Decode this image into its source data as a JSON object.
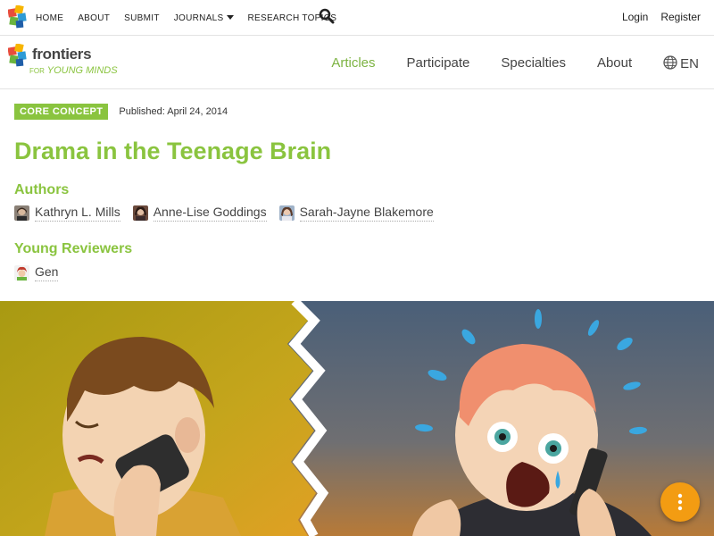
{
  "topbar": {
    "nav": [
      {
        "label": "HOME"
      },
      {
        "label": "ABOUT"
      },
      {
        "label": "SUBMIT"
      },
      {
        "label": "JOURNALS",
        "has_dropdown": true
      },
      {
        "label": "RESEARCH TOPICS"
      }
    ],
    "search_icon": "search-icon",
    "login_label": "Login",
    "register_label": "Register"
  },
  "site": {
    "brand": "frontiers",
    "tagline_for": "FOR",
    "tagline_name": "YOUNG MINDS"
  },
  "mainnav": {
    "items": [
      {
        "label": "Articles",
        "active": true
      },
      {
        "label": "Participate"
      },
      {
        "label": "Specialties"
      },
      {
        "label": "About"
      }
    ],
    "language": "EN",
    "language_icon": "globe-icon"
  },
  "article": {
    "badge": "CORE CONCEPT",
    "published": "Published: April 24, 2014",
    "title": "Drama in the Teenage Brain",
    "authors_heading": "Authors",
    "authors": [
      "Kathryn L. Mills",
      "Anne-Lise Goddings",
      "Sarah-Jayne Blakemore"
    ],
    "reviewers_heading": "Young Reviewers",
    "reviewers": [
      "Gen"
    ]
  },
  "fab_icon": "more-vertical-icon",
  "colors": {
    "accent": "#8ac43f",
    "active_nav": "#7cb342",
    "fab": "#f39c12"
  }
}
